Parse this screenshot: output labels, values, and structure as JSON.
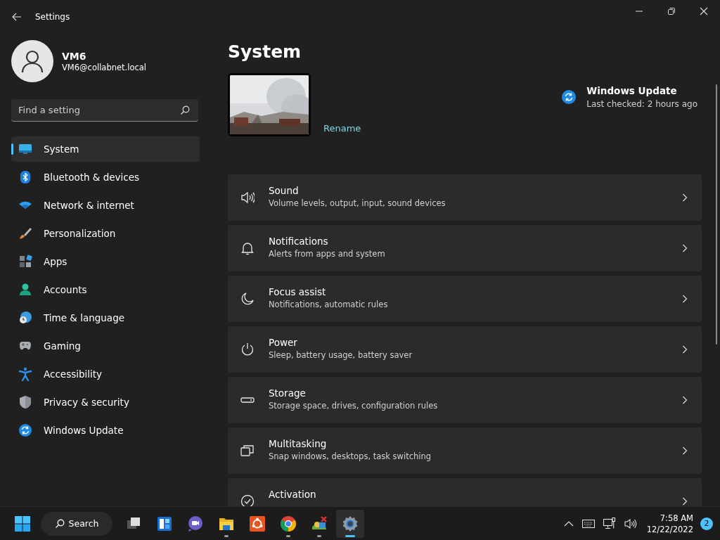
{
  "window": {
    "title": "Settings"
  },
  "user": {
    "name": "VM6",
    "email": "VM6@collabnet.local"
  },
  "search": {
    "placeholder": "Find a setting"
  },
  "sidebar": {
    "items": [
      {
        "label": "System",
        "selected": true
      },
      {
        "label": "Bluetooth & devices",
        "selected": false
      },
      {
        "label": "Network & internet",
        "selected": false
      },
      {
        "label": "Personalization",
        "selected": false
      },
      {
        "label": "Apps",
        "selected": false
      },
      {
        "label": "Accounts",
        "selected": false
      },
      {
        "label": "Time & language",
        "selected": false
      },
      {
        "label": "Gaming",
        "selected": false
      },
      {
        "label": "Accessibility",
        "selected": false
      },
      {
        "label": "Privacy & security",
        "selected": false
      },
      {
        "label": "Windows Update",
        "selected": false
      }
    ]
  },
  "page": {
    "title": "System"
  },
  "device": {
    "rename": "Rename"
  },
  "update": {
    "title": "Windows Update",
    "status": "Last checked: 2 hours ago"
  },
  "settings": [
    {
      "title": "Sound",
      "description": "Volume levels, output, input, sound devices"
    },
    {
      "title": "Notifications",
      "description": "Alerts from apps and system"
    },
    {
      "title": "Focus assist",
      "description": "Notifications, automatic rules"
    },
    {
      "title": "Power",
      "description": "Sleep, battery usage, battery saver"
    },
    {
      "title": "Storage",
      "description": "Storage space, drives, configuration rules"
    },
    {
      "title": "Multitasking",
      "description": "Snap windows, desktops, task switching"
    },
    {
      "title": "Activation"
    }
  ],
  "taskbar": {
    "search": "Search",
    "apps": [
      {
        "selected": false,
        "running": false
      },
      {
        "selected": false,
        "running": false
      },
      {
        "selected": false,
        "running": false
      },
      {
        "selected": false,
        "running": true
      },
      {
        "selected": false,
        "running": false
      },
      {
        "selected": false,
        "running": true
      },
      {
        "selected": false,
        "running": true
      },
      {
        "selected": true,
        "running": true
      }
    ],
    "time": "7:58 AM",
    "date": "12/22/2022",
    "notifications": "2"
  }
}
